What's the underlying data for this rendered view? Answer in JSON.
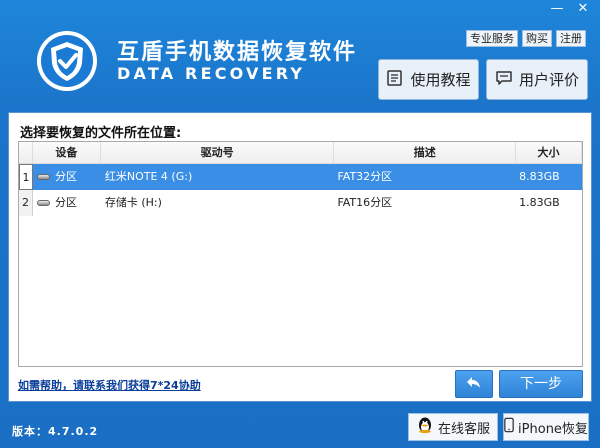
{
  "window": {
    "controls": {
      "minimize": "—",
      "close": "✕"
    }
  },
  "top_links": [
    "专业服务",
    "购买",
    "注册"
  ],
  "header": {
    "title_cn": "互盾手机数据恢复软件",
    "title_en": "DATA RECOVERY",
    "tutorial_label": "使用教程",
    "review_label": "用户评价"
  },
  "panel": {
    "title": "选择要恢复的文件所在位置:",
    "columns": [
      "设备",
      "驱动号",
      "描述",
      "大小"
    ],
    "rows": [
      {
        "num": "1",
        "device": "分区",
        "drive": "红米NOTE 4 (G:)",
        "desc": "FAT32分区",
        "size": "8.83GB",
        "selected": true
      },
      {
        "num": "2",
        "device": "分区",
        "drive": "存储卡 (H:)",
        "desc": "FAT16分区",
        "size": "1.83GB",
        "selected": false
      }
    ],
    "help_link": "如需帮助，请联系我们获得7*24协助",
    "next_label": "下一步"
  },
  "footer": {
    "version": "版本：4.7.0.2",
    "online_service": "在线客服",
    "iphone_recovery": "iPhone恢复"
  },
  "colors": {
    "accent": "#1b74c9",
    "selected_row": "#3a8ee6",
    "button_blue": "#2f83d6"
  }
}
